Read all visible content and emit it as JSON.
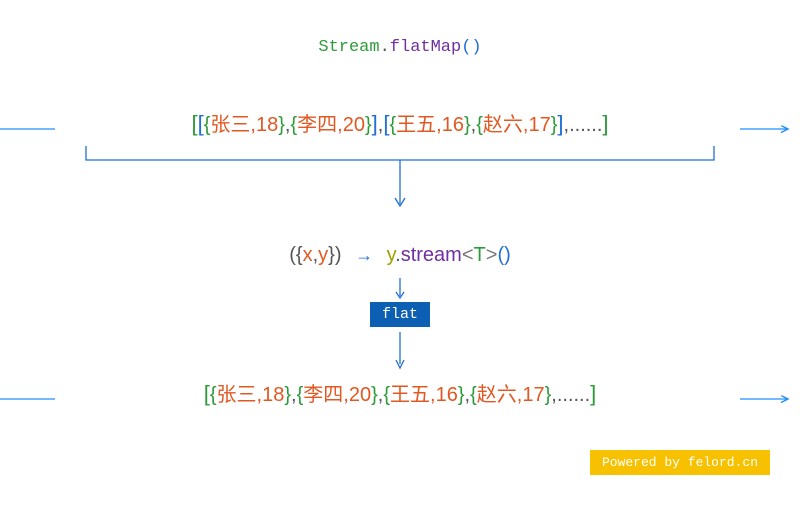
{
  "title": {
    "cls": "Stream",
    "dot": ".",
    "method": "flatMap",
    "call": "()"
  },
  "input": {
    "groups": [
      {
        "items": [
          {
            "name": "张三",
            "age": "18"
          },
          {
            "name": "李四",
            "age": "20"
          }
        ]
      },
      {
        "items": [
          {
            "name": "王五",
            "age": "16"
          },
          {
            "name": "赵六",
            "age": "17"
          }
        ]
      }
    ],
    "ellipsis": "......"
  },
  "lambda": {
    "x": "x",
    "y": "y",
    "method": "stream",
    "tparam": "T",
    "call": "()"
  },
  "flat_label": "flat",
  "output": {
    "items": [
      {
        "name": "张三",
        "age": "18"
      },
      {
        "name": "李四",
        "age": "20"
      },
      {
        "name": "王五",
        "age": "16"
      },
      {
        "name": "赵六",
        "age": "17"
      }
    ],
    "ellipsis": "......"
  },
  "watermark": "Powered by felord.cn"
}
